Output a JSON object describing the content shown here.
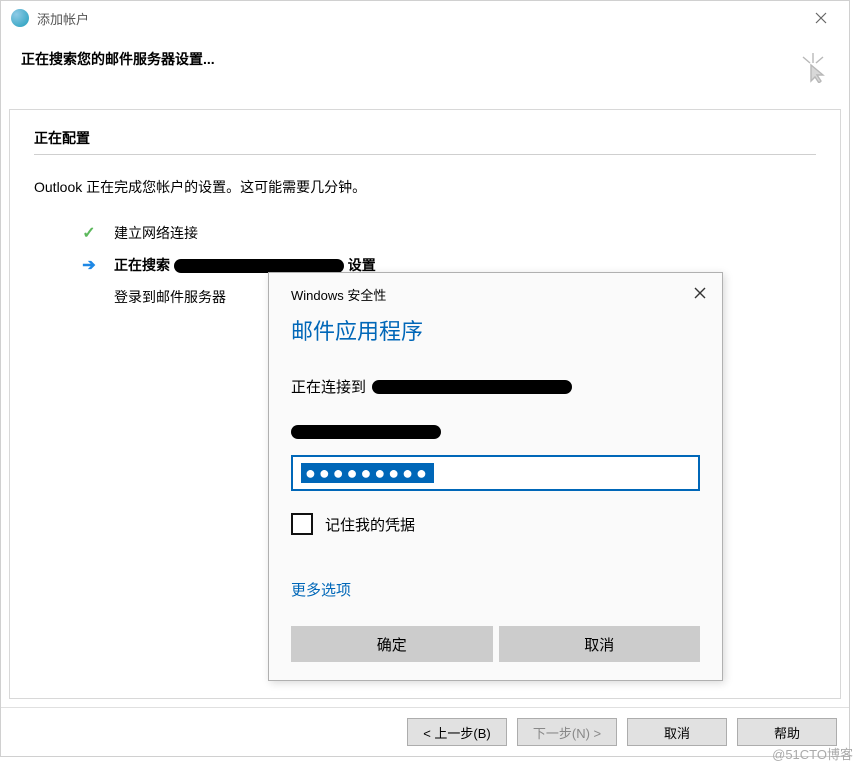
{
  "titlebar": {
    "title": "添加帐户"
  },
  "header": {
    "heading": "正在搜索您的邮件服务器设置..."
  },
  "section": {
    "title": "正在配置",
    "info": "Outlook 正在完成您帐户的设置。这可能需要几分钟。",
    "steps": {
      "s1": "建立网络连接",
      "s2_prefix": "正在搜索",
      "s2_suffix": "设置",
      "s3": "登录到邮件服务器"
    }
  },
  "footer": {
    "back": "< 上一步(B)",
    "next": "下一步(N) >",
    "cancel": "取消",
    "help": "帮助"
  },
  "security_dialog": {
    "title": "Windows 安全性",
    "heading": "邮件应用程序",
    "connecting_prefix": "正在连接到",
    "password_mask": "●●●●●●●●●",
    "remember_label": "记住我的凭据",
    "more_options": "更多选项",
    "ok": "确定",
    "cancel": "取消"
  },
  "watermark": "@51CTO博客"
}
